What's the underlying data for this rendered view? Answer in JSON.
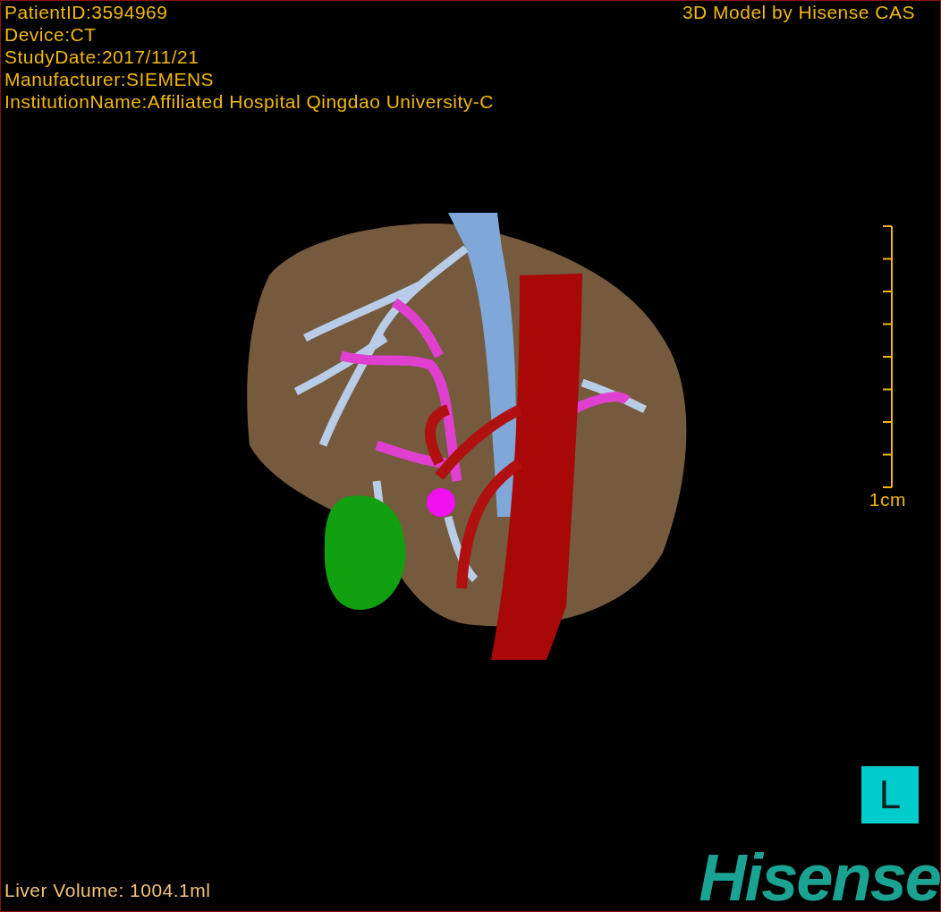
{
  "info_lines": [
    "PatientID:3594969",
    "Device:CT",
    "StudyDate:2017/11/21",
    "Manufacturer:SIEMENS",
    "InstitutionName:Affiliated Hospital Qingdao University-C"
  ],
  "credit": "3D Model by Hisense CAS",
  "scale_bar": {
    "label": "1cm"
  },
  "orientation_marker": "L",
  "liver_volume": "Liver Volume: 1004.1ml",
  "logo": "Hisense"
}
